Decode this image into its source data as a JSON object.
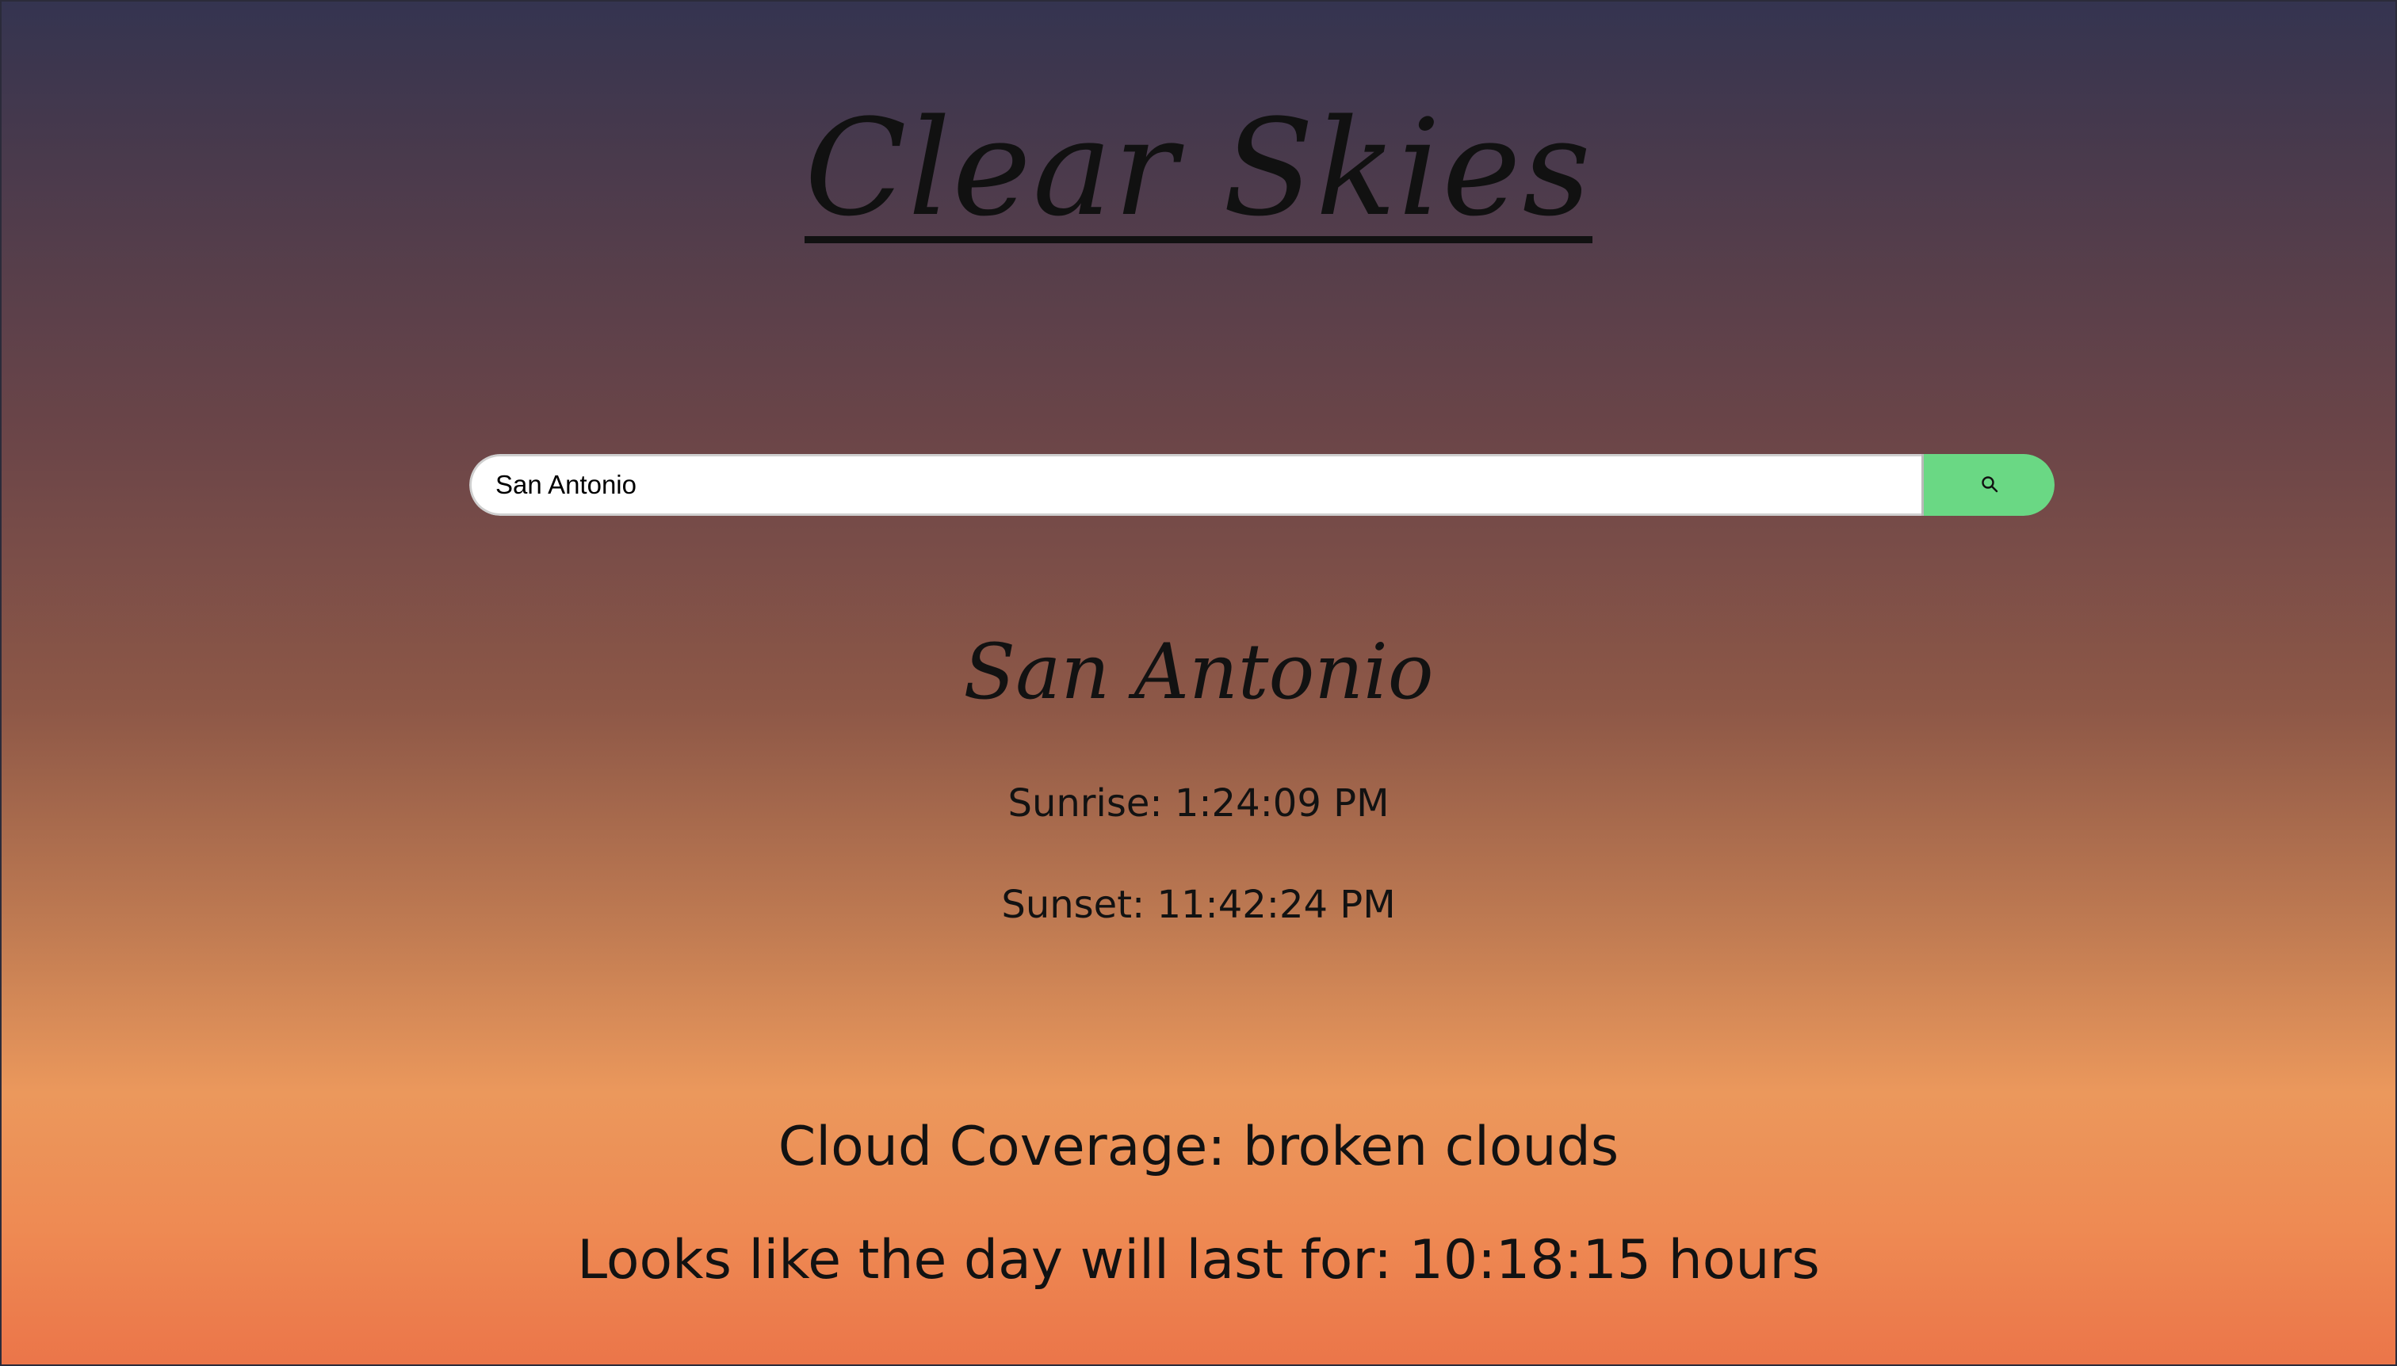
{
  "header": {
    "title": "Clear Skies"
  },
  "search": {
    "value": "San Antonio",
    "icon": "search-icon",
    "button_color": "#6ad884"
  },
  "weather": {
    "city": "San Antonio",
    "sunrise": "Sunrise: 1:24:09 PM",
    "sunset": "Sunset: 11:42:24 PM",
    "cloud_coverage": "Cloud Coverage: broken clouds",
    "day_length": "Looks like the day will last for: 10:18:15 hours"
  }
}
